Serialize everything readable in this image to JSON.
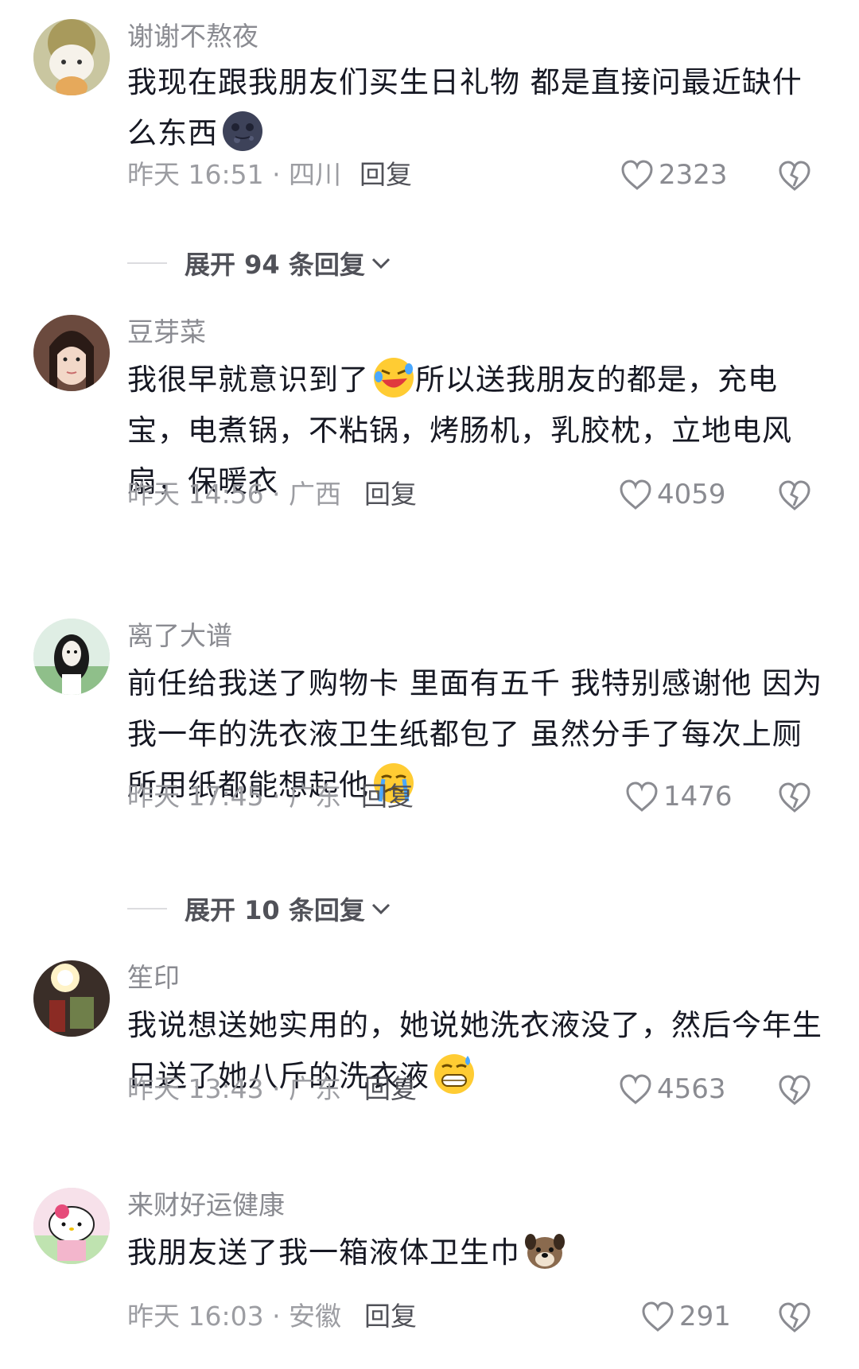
{
  "comments": [
    {
      "username": "谢谢不熬夜",
      "text": "我现在跟我朋友们买生日礼物 都是直接问最近缺什么东西",
      "emoji": "moon-face",
      "time_location": "昨天 16:51 · 四川",
      "reply_label": "回复",
      "likes": "2323",
      "expand_label": "展开 94 条回复"
    },
    {
      "username": "豆芽菜",
      "text": "我很早就意识到了",
      "text_after_emoji": "所以送我朋友的都是，充电宝，电煮锅，不粘锅，烤肠机，乳胶枕，立地电风扇，保暖衣",
      "emoji": "rolling-laugh",
      "time_location": "昨天 14:56 · 广西",
      "reply_label": "回复",
      "likes": "4059"
    },
    {
      "username": "离了大谱",
      "text": "前任给我送了购物卡 里面有五千 我特别感谢他 因为我一年的洗衣液卫生纸都包了 虽然分手了每次上厕所用纸都能想起他",
      "emoji": "crying-face",
      "time_location": "昨天 17:45 · 广东",
      "reply_label": "回复",
      "likes": "1476",
      "expand_label": "展开 10 条回复"
    },
    {
      "username": "笙印",
      "text": "我说想送她实用的，她说她洗衣液没了，然后今年生日送了她八斤的洗衣液",
      "emoji": "grin-sweat",
      "time_location": "昨天 13:43 · 广东",
      "reply_label": "回复",
      "likes": "4563"
    },
    {
      "username": "来财好运健康",
      "text": "我朋友送了我一箱液体卫生巾",
      "emoji": "dog-face",
      "time_location": "昨天 16:03 · 安徽",
      "reply_label": "回复",
      "likes": "291"
    }
  ]
}
